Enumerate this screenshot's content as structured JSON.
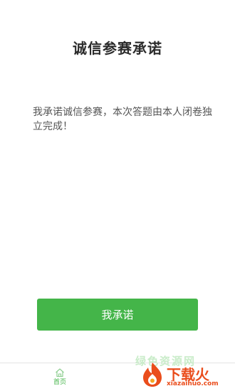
{
  "page": {
    "title": "诚信参赛承诺",
    "pledge_text": "我承诺诚信参赛，本次答题由本人闭卷独立完成！",
    "pledge_button_label": "我承诺"
  },
  "tabbar": {
    "home_label": "首页"
  },
  "watermark": {
    "ghost_text": "绿色资源网",
    "brand": "下载火",
    "domain": "xiazaihuo.com"
  },
  "colors": {
    "accent": "#44b549",
    "title": "#2b2b2b",
    "body_text": "#555555",
    "watermark_orange": "#ea4d1c"
  },
  "icons": {
    "home": "home-icon",
    "logo": "flame-logo-icon"
  }
}
